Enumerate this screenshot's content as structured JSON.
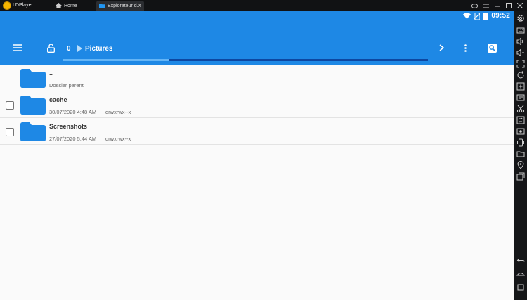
{
  "window": {
    "app_name": "LDPlayer",
    "tabs": [
      {
        "label": "Home"
      },
      {
        "label": "Explorateur d..."
      }
    ],
    "close_tab_glyph": "×"
  },
  "status_bar": {
    "time": "09:52",
    "icons": [
      "wifi-icon",
      "no-sim-icon",
      "battery-icon"
    ]
  },
  "app_bar": {
    "icons": [
      "menu-icon",
      "lock-icon",
      "chevron-right-icon",
      "more-vert-icon",
      "search-icon"
    ],
    "path_count": "0",
    "current_folder": "Pictures",
    "progress_percent": 29
  },
  "files": [
    {
      "name": "..",
      "detail": "Dossier parent",
      "has_checkbox": false
    },
    {
      "name": "cache",
      "date": "30/07/2020 4:48 AM",
      "permissions": "drwxrwx--x",
      "has_checkbox": true
    },
    {
      "name": "Screenshots",
      "date": "27/07/2020 5:44 AM",
      "permissions": "drwxrwx--x",
      "has_checkbox": true
    }
  ],
  "colors": {
    "primary": "#1e88e5",
    "folder": "#1e88e5",
    "progress_track": "#0d47a1",
    "progress_fill": "#64b5f6"
  },
  "side_toolbar": {
    "tools": [
      "gear-icon",
      "keyboard-icon",
      "volume-up-icon",
      "volume-down-icon",
      "screen-size-icon",
      "rotate-icon",
      "add-app-icon",
      "apk-icon",
      "scissors-icon",
      "sync-icon",
      "record-icon",
      "shake-icon",
      "folder-icon",
      "location-icon",
      "multi-instance-icon",
      "back-icon",
      "home-icon",
      "recent-apps-icon"
    ]
  }
}
